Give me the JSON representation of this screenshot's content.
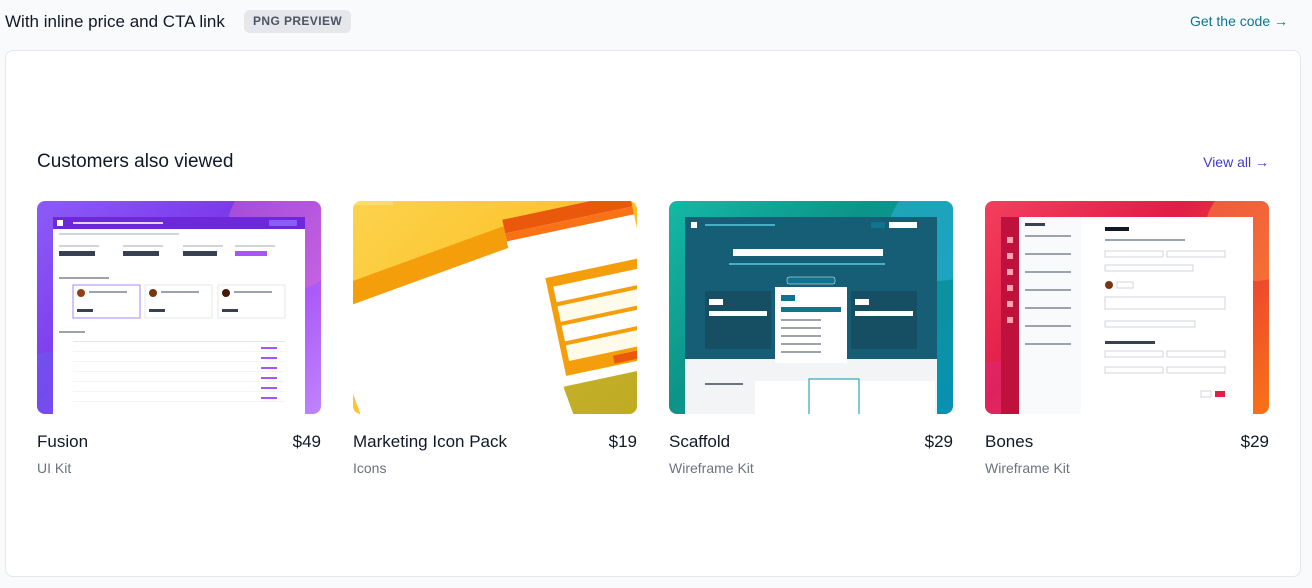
{
  "header": {
    "title": "With inline price and CTA link",
    "badge": "PNG PREVIEW",
    "cta": "Get the code →"
  },
  "section": {
    "title": "Customers also viewed",
    "view_all": "View all →"
  },
  "products": [
    {
      "name": "Fusion",
      "price": "$49",
      "category": "UI Kit",
      "thumb": "fusion-ui-kit-preview"
    },
    {
      "name": "Marketing Icon Pack",
      "price": "$19",
      "category": "Icons",
      "thumb": "marketing-icon-pack-preview"
    },
    {
      "name": "Scaffold",
      "price": "$29",
      "category": "Wireframe Kit",
      "thumb": "scaffold-wireframe-preview"
    },
    {
      "name": "Bones",
      "price": "$29",
      "category": "Wireframe Kit",
      "thumb": "bones-wireframe-preview"
    }
  ],
  "colors": {
    "cta": "#0e7490",
    "view_all": "#4338ca",
    "fusion_bg": "#7c3aed",
    "icons_bg": "#fbbf24",
    "scaffold_bg": "#0e7490",
    "bones_bg": "#f43f5e"
  }
}
